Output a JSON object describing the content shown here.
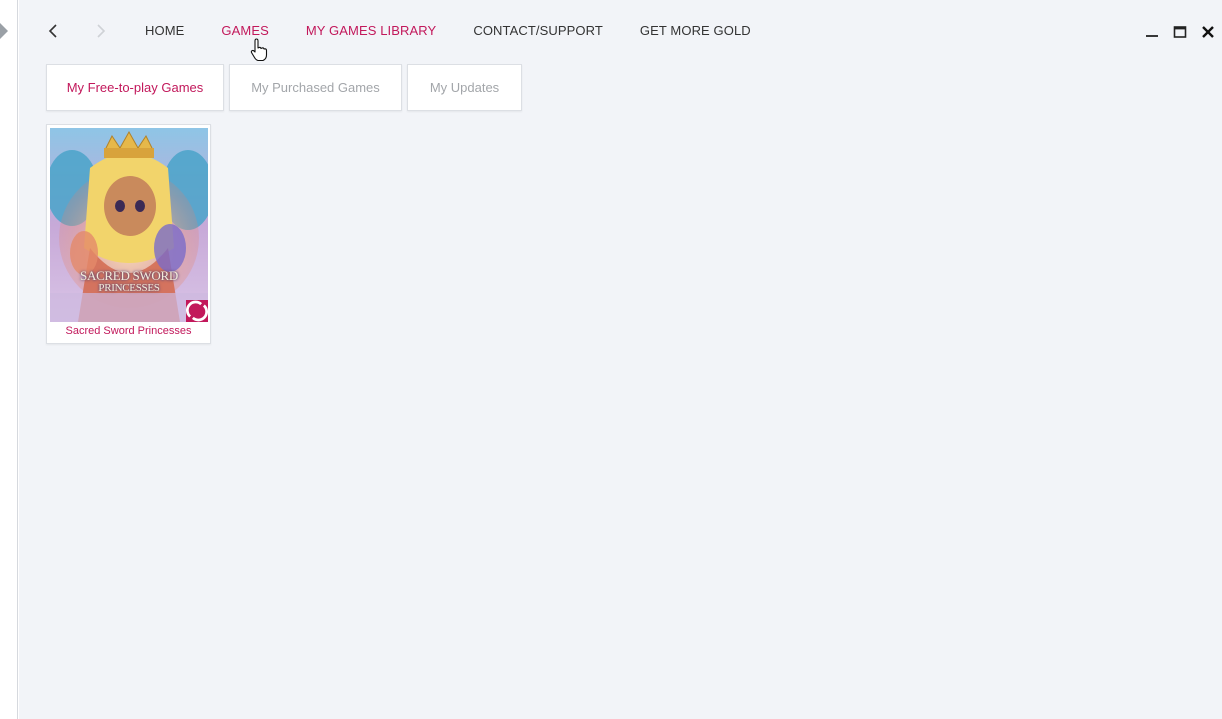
{
  "nav": {
    "back_icon": "chevron-left-icon",
    "forward_icon": "chevron-right-icon",
    "items": [
      {
        "label": "HOME",
        "active": false
      },
      {
        "label": "GAMES",
        "active": true
      },
      {
        "label": "MY GAMES LIBRARY",
        "active": true
      },
      {
        "label": "CONTACT/SUPPORT",
        "active": false
      },
      {
        "label": "GET MORE GOLD",
        "active": false
      }
    ]
  },
  "window": {
    "minimize_icon": "minimize-icon",
    "maximize_icon": "maximize-icon",
    "close_icon": "close-icon"
  },
  "tabs": [
    {
      "label": "My Free-to-play Games",
      "active": true
    },
    {
      "label": "My Purchased Games",
      "active": false
    },
    {
      "label": "My Updates",
      "active": false
    }
  ],
  "games": [
    {
      "title": "Sacred Sword Princesses",
      "cover_title": "SACRED SWORD PRINCESSES",
      "badge_icon": "publisher-logo-icon"
    }
  ],
  "colors": {
    "accent": "#c2185b",
    "background": "#f2f4f8",
    "text": "#333333",
    "muted": "#a3a6aa"
  }
}
